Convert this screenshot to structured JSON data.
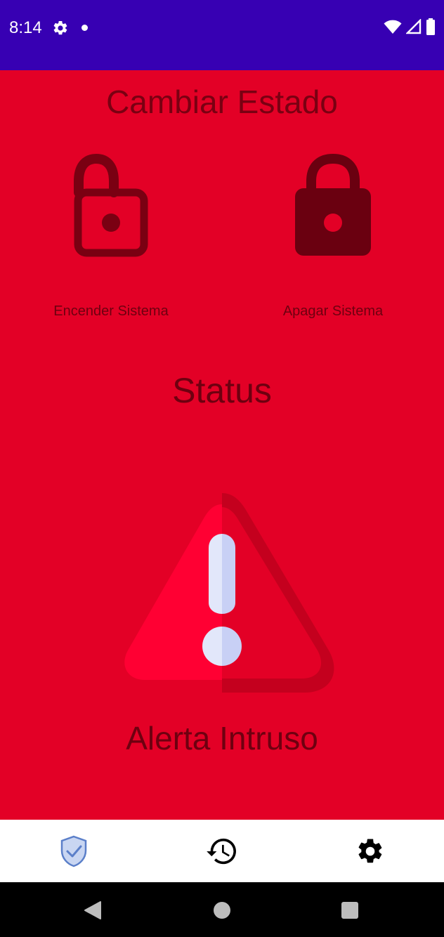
{
  "status_bar": {
    "time": "8:14",
    "icons": [
      "gear-icon",
      "notification-dot-icon",
      "wifi-icon",
      "signal-icon",
      "battery-icon"
    ],
    "background": "#3700B3"
  },
  "main": {
    "background": "#E30026",
    "title": "Cambiar Estado",
    "lock_on": {
      "icon": "lock-open-icon",
      "label": "Encender Sistema"
    },
    "lock_off": {
      "icon": "lock-closed-icon",
      "label": "Apagar Sistema"
    },
    "status_heading": "Status",
    "alert": {
      "icon": "warning-icon",
      "label": "Alerta Intruso"
    }
  },
  "bottom_nav": {
    "items": [
      {
        "icon": "shield-check-icon",
        "selected": true
      },
      {
        "icon": "history-icon",
        "selected": false
      },
      {
        "icon": "settings-gear-icon",
        "selected": false
      }
    ],
    "accent": "#5B7FC9"
  },
  "system_nav": {
    "buttons": [
      "back-icon",
      "home-icon",
      "recents-icon"
    ]
  }
}
